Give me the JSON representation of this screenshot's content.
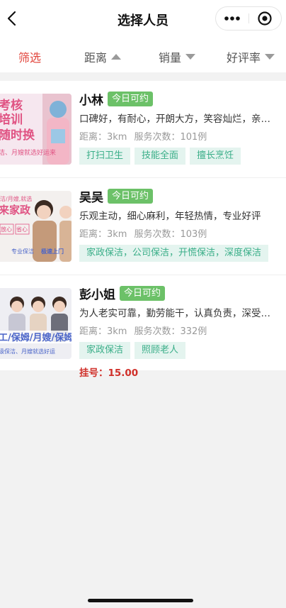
{
  "header": {
    "title": "选择人员",
    "back_icon": "chevron-left-icon",
    "more_icon": "more-dots-icon",
    "close_icon": "target-close-icon"
  },
  "filters": [
    {
      "label": "筛选",
      "active": true,
      "arrow": "none"
    },
    {
      "label": "距离",
      "active": false,
      "arrow": "up"
    },
    {
      "label": "销量",
      "active": false,
      "arrow": "down"
    },
    {
      "label": "好评率",
      "active": false,
      "arrow": "down"
    }
  ],
  "workers": [
    {
      "name": "小林",
      "status": "今日可约",
      "desc": "口碑好，有耐心，开朗大方，笑容灿烂，亲和…",
      "distance": "距离：3km",
      "service_count": "服务次数：101例",
      "tags": [
        "打扫卫生",
        "技能全面",
        "擅长烹饪"
      ],
      "thumb_text": [
        "考核",
        "培训",
        "随时换",
        "洁、月嫂就选好运来"
      ]
    },
    {
      "name": "吴吴",
      "status": "今日可约",
      "desc": "乐观主动，细心麻利，年轻热情，专业好评",
      "distance": "距离：3km",
      "service_count": "服务次数：103例",
      "tags": [
        "家政保洁，公司保洁，开慌保洁，深度保洁"
      ],
      "thumb_text": [
        "洁/月嫂,就选",
        "来家政",
        "放心",
        "省心",
        "专业保洁",
        "极速上门"
      ]
    },
    {
      "name": "彭小姐",
      "status": "今日可约",
      "desc": "为人老实可靠，勤劳能干，认真负责，深受客…",
      "distance": "距离：3km",
      "service_count": "服务次数：332例",
      "tags": [
        "家政保洁",
        "照顾老人"
      ],
      "fee": "挂号：15.00",
      "thumb_text": [
        "工/保姆/月嫂/保姆",
        "级保洁、月嫂就选好运"
      ]
    }
  ],
  "colors": {
    "accent_red": "#e2453c",
    "status_green": "#6cc168",
    "tag_bg": "#e4f4ef",
    "tag_text": "#3aae88",
    "fee_red": "#d0302a"
  }
}
